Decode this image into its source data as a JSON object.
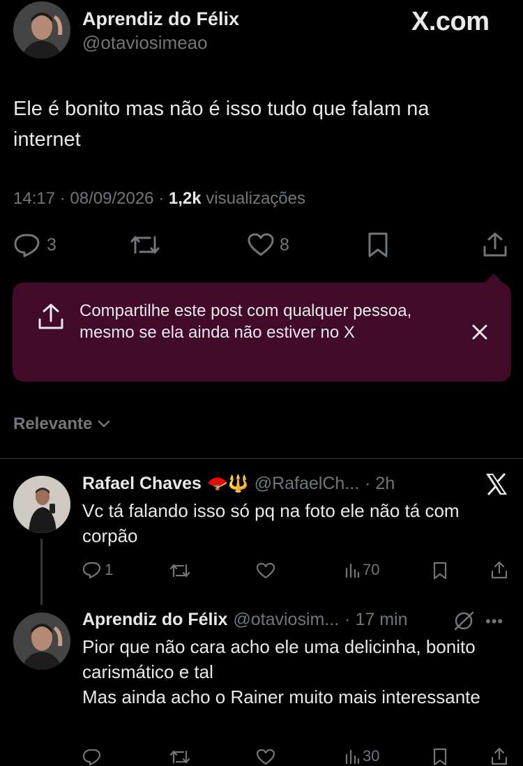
{
  "header": {
    "author_name": "Aprendiz do Félix",
    "author_handle": "@otaviosimeao",
    "brand": "X.com"
  },
  "post": {
    "text": "Ele é bonito mas não é isso tudo que falam na internet",
    "time": "14:17",
    "date": "08/09/2026",
    "views_count": "1,2k",
    "views_label": "visualizações",
    "actions": {
      "replies": "3",
      "likes": "8"
    }
  },
  "share_banner": {
    "text": "Compartilhe este post com qualquer pessoa, mesmo se ela ainda não estiver no X",
    "color": "#410a28"
  },
  "sort": {
    "label": "Relevante"
  },
  "replies": [
    {
      "name": "Rafael Chaves",
      "emoji": "🪭🔱",
      "handle": "@RafaelCh...",
      "time": "· 2h",
      "text": "Vc tá falando isso só pq na foto ele não tá com corpão",
      "replies": "1",
      "views": "70"
    },
    {
      "name": "Aprendiz do Félix",
      "handle": "@otaviosim...",
      "time": "· 17 min",
      "text": "Pior que não cara acho ele uma delicinha, bonito carismático e tal\nMas ainda acho o Rainer muito mais interessante",
      "views": "30"
    }
  ],
  "colors": {
    "background": "#000000",
    "text": "#e7e9ea",
    "muted": "#71767b"
  }
}
